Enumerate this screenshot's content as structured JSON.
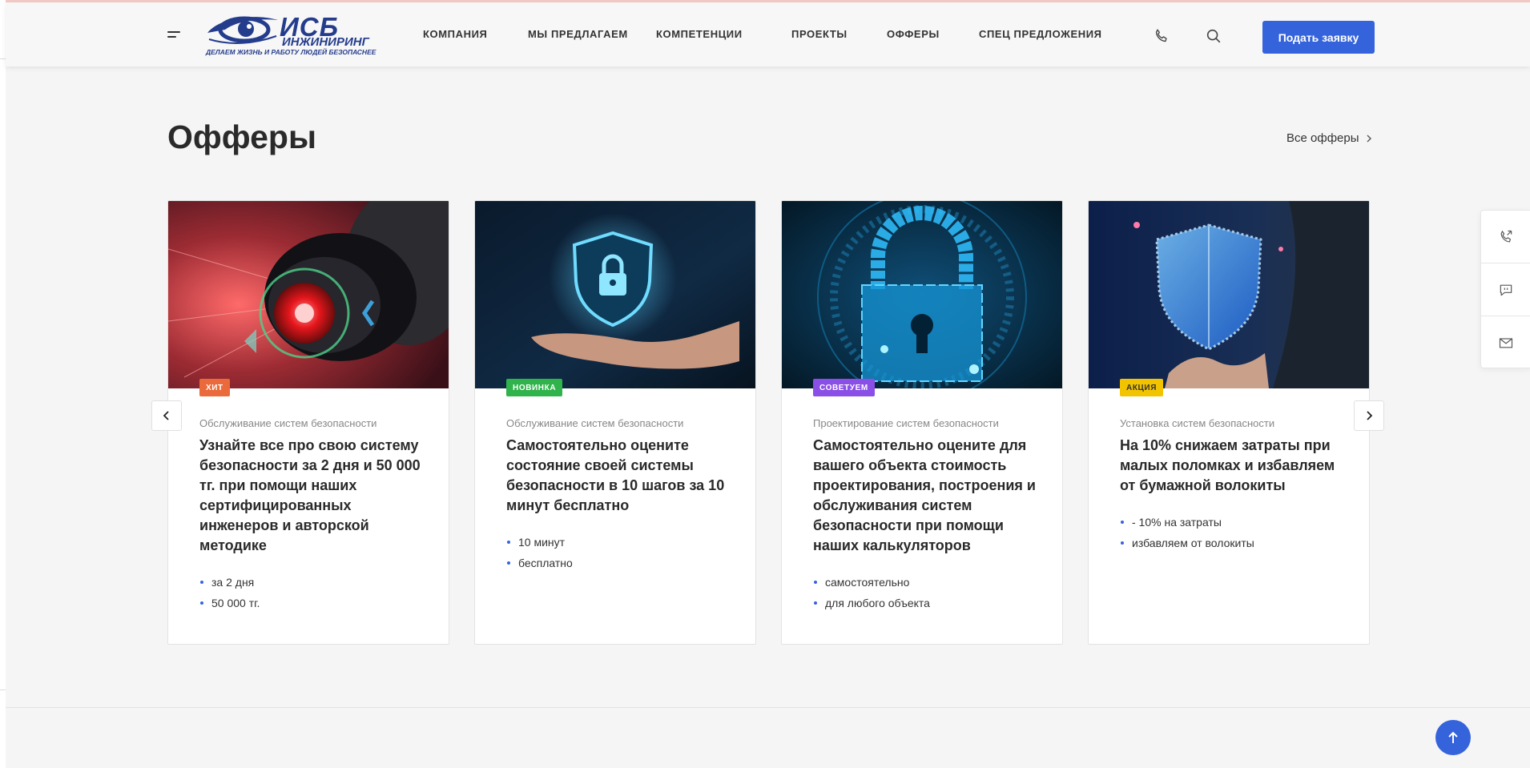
{
  "colors": {
    "accent": "#3463db",
    "brand": "#243c8c",
    "badge_hit": "#ea6a3b",
    "badge_new": "#2fb34a",
    "badge_advise": "#8a4fe6",
    "badge_promo": "#f2c400"
  },
  "header": {
    "logo": {
      "main": "ИСБ",
      "sub": "ИНЖИНИРИНГ",
      "slogan": "ДЕЛАЕМ ЖИЗНЬ И РАБОТУ ЛЮДЕЙ БЕЗОПАСНЕЕ"
    },
    "nav": [
      "КОМПАНИЯ",
      "МЫ ПРЕДЛАГАЕМ",
      "КОМПЕТЕНЦИИ",
      "ПРОЕКТЫ",
      "ОФФЕРЫ",
      "СПЕЦ ПРЕДЛОЖЕНИЯ"
    ],
    "icons": {
      "menu": "hamburger-menu-icon",
      "phone": "phone-icon",
      "search": "search-icon"
    },
    "cta_label": "Подать заявку"
  },
  "section": {
    "title": "Офферы",
    "all_link": "Все офферы"
  },
  "cards": [
    {
      "badge": "ХИТ",
      "category": "Обслуживание систем безопасности",
      "title": "Узнайте все про свою систему безопасности за 2 дня и 50 000 тг. при помощи наших сертифицированных инженеров и авторской методике",
      "features": [
        "за 2 дня",
        "50 000 тг."
      ],
      "image": "security-camera-image"
    },
    {
      "badge": "НОВИНКА",
      "category": "Обслуживание систем безопасности",
      "title": "Самостоятельно оцените состояние своей системы безопасности в 10 шагов за 10 минут бесплатно",
      "features": [
        "10 минут",
        "бесплатно"
      ],
      "image": "hand-shield-lock-image"
    },
    {
      "badge": "СОВЕТУЕМ",
      "category": "Проектирование систем безопасности",
      "title": "Самостоятельно оцените для вашего объекта стоимость проектирования, построения и обслуживания систем безопасности при помощи наших калькуляторов",
      "features": [
        "самостоятельно",
        "для любого объекта"
      ],
      "image": "digital-padlock-image"
    },
    {
      "badge": "АКЦИЯ",
      "category": "Установка систем безопасности",
      "title": "На 10% снижаем затраты при малых поломках и избавляем от бумажной волокиты",
      "features": [
        "- 10% на затраты",
        "избавляем от волокиты"
      ],
      "image": "businessman-shield-image"
    }
  ],
  "side_panel": [
    "callback-icon",
    "chat-icon",
    "mail-icon"
  ]
}
